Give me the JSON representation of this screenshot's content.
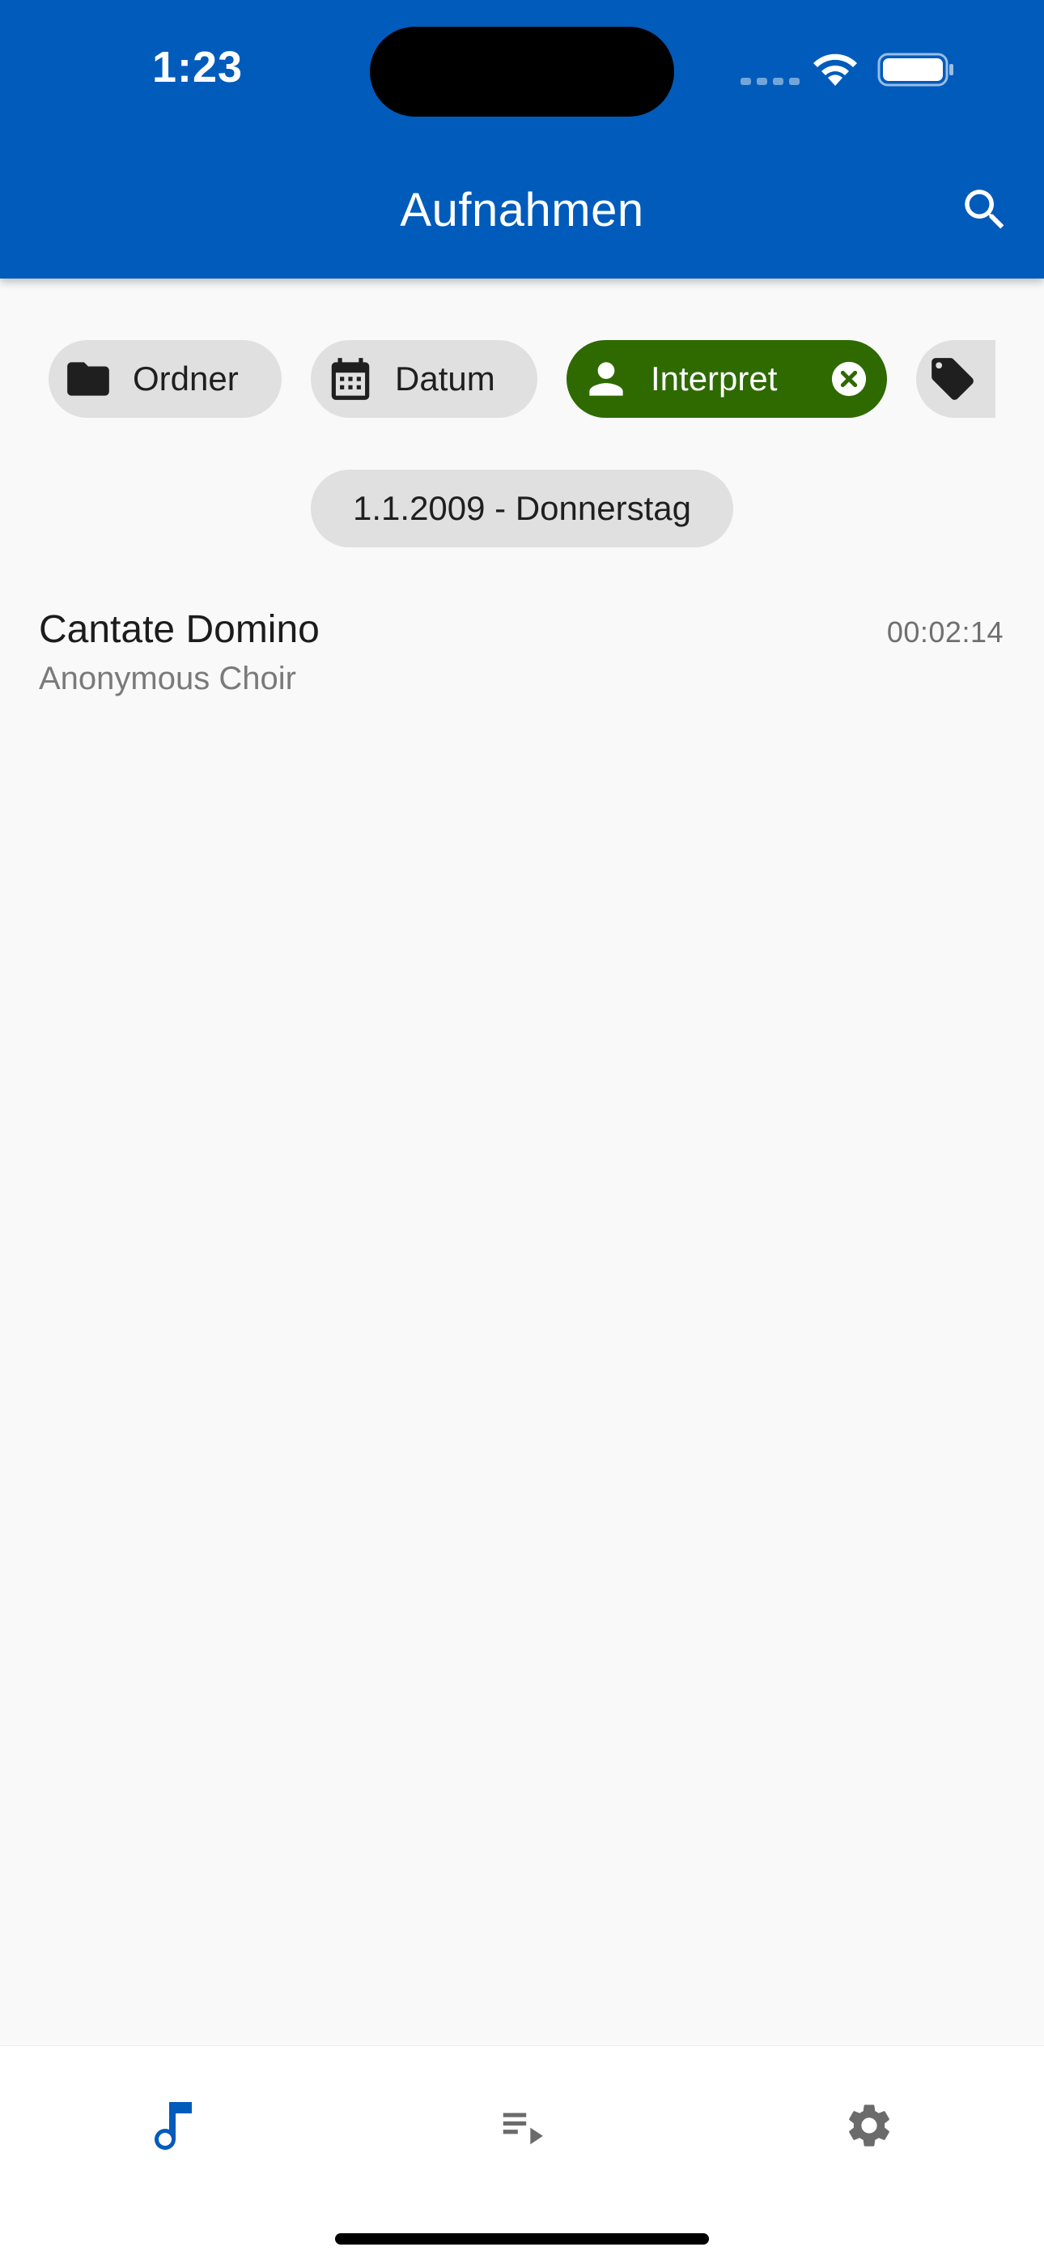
{
  "status_bar": {
    "time": "1:23"
  },
  "header": {
    "title": "Aufnahmen"
  },
  "filters": {
    "folder_label": "Ordner",
    "date_label": "Datum",
    "artist_label": "Interpret",
    "artist_active": true
  },
  "date_group": {
    "label": "1.1.2009 - Donnerstag"
  },
  "recordings": [
    {
      "title": "Cantate Domino",
      "artist": "Anonymous Choir",
      "duration": "00:02:14"
    }
  ],
  "colors": {
    "primary": "#005bbb",
    "active_chip": "#2e6a00",
    "chip_bg": "#e0e0e0",
    "background": "#f9f9f9",
    "nav_active": "#005bbb",
    "nav_inactive": "#6b6b6b"
  },
  "icons": {
    "search": "search-icon",
    "folder": "folder-icon",
    "date": "calendar-icon",
    "artist": "person-icon",
    "clear": "close-circle-icon",
    "tag": "tag-icon",
    "recordings": "music-note-icon",
    "playlist": "playlist-play-icon",
    "settings": "gear-icon"
  }
}
